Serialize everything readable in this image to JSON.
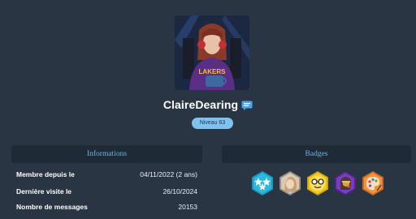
{
  "profile": {
    "username": "ClaireDearing",
    "level": "Niveau 63",
    "avatar_icon": "avatar-photo-icon",
    "message_icon": "message-icon"
  },
  "information": {
    "title": "Informations",
    "rows": [
      {
        "label": "Membre depuis le",
        "value": "04/11/2022 (2 ans)"
      },
      {
        "label": "Dernière visite le",
        "value": "26/10/2024"
      },
      {
        "label": "Nombre de messages",
        "value": "20153"
      }
    ]
  },
  "badges": {
    "title": "Badges",
    "items": [
      {
        "icon": "stars-hexagon-icon",
        "color": "#27b5d9"
      },
      {
        "icon": "portrait-hexagon-icon",
        "color": "#c8b7a5"
      },
      {
        "icon": "glasses-face-hexagon-icon",
        "color": "#f3c622"
      },
      {
        "icon": "cyborg-hexagon-icon",
        "color": "#7a3bc2"
      },
      {
        "icon": "palette-hexagon-icon",
        "color": "#f08a3d"
      }
    ]
  },
  "colors": {
    "background": "#2a3544",
    "panel": "#1f2a37",
    "accent": "#6eb4e6",
    "level_badge": "#7ec3f0"
  }
}
